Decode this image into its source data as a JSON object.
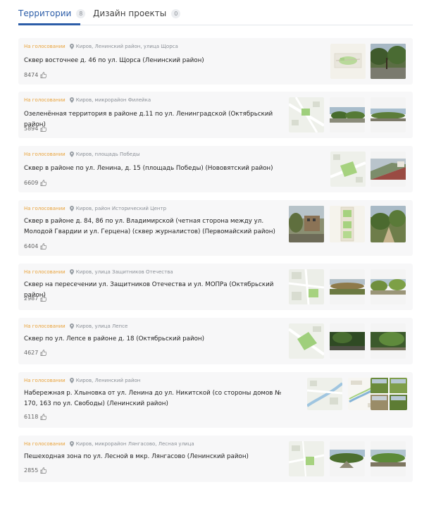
{
  "tabs": [
    {
      "label": "Территории",
      "count": "8",
      "active": true
    },
    {
      "label": "Дизайн проекты",
      "count": "0",
      "active": false
    }
  ],
  "colors": {
    "accent": "#2c5da8",
    "status": "#e8a33c",
    "card_bg": "#f7f7f8"
  },
  "icons": {
    "location": "map-pin-icon",
    "like": "thumbs-up-icon"
  },
  "items": [
    {
      "status": "На голосовании",
      "location": "Киров, Ленинский район, улица Щорса",
      "title": "Сквер восточнее д. 46 по ул. Щорса (Ленинский район)",
      "likes": "8474",
      "images": [
        "plan-image",
        "photo-image"
      ]
    },
    {
      "status": "На голосовании",
      "location": "Киров, микрорайон Филейка",
      "title": "Озеленённая территория в районе д.11 по ул. Ленинградской (Октябрьский район)",
      "likes": "5894",
      "images": [
        "map-image",
        "photo-image",
        "photo-image"
      ]
    },
    {
      "status": "На голосовании",
      "location": "Киров, площадь Победы",
      "title": "Сквер в районе по ул. Ленина, д. 15 (площадь Победы) (Нововятский район)",
      "likes": "6609",
      "images": [
        "map-image",
        "photo-image"
      ]
    },
    {
      "status": "На голосовании",
      "location": "Киров, район Исторический Центр",
      "title": "Сквер в районе д. 84, 86 по ул. Владимирской (четная сторона между ул. Молодой Гвардии и ул. Герцена) (сквер журналистов) (Первомайский район)",
      "likes": "6404",
      "images": [
        "photo-image",
        "plan-image",
        "photo-image"
      ]
    },
    {
      "status": "На голосовании",
      "location": "Киров, улица Защитников Отечества",
      "title": "Сквер на пересечении ул. Защитников Отечества и ул. МОПРа (Октябрьский район)",
      "likes": "2987",
      "images": [
        "map-image",
        "photo-image",
        "photo-image"
      ]
    },
    {
      "status": "На голосовании",
      "location": "Киров, улица Лепсе",
      "title": "Сквер по ул. Лепсе в районе д. 18 (Октябрьский район)",
      "likes": "4627",
      "images": [
        "map-image",
        "photo-image",
        "photo-image"
      ]
    },
    {
      "status": "На голосовании",
      "location": "Киров, Ленинский район",
      "title": "Набережная р. Хлыновка от ул. Ленина до ул. Никитской (со стороны домов № 170, 163 по ул. Свободы) (Ленинский район)",
      "likes": "6118",
      "images": [
        "map-image",
        "plan-image",
        "photo-grid-image"
      ]
    },
    {
      "status": "На голосовании",
      "location": "Киров, микрорайон Лянгасово, Лесная улица",
      "title": "Пешеходная зона по ул. Лесной в мкр. Лянгасово (Ленинский район)",
      "likes": "2855",
      "images": [
        "map-image",
        "photo-image",
        "photo-image"
      ]
    }
  ]
}
